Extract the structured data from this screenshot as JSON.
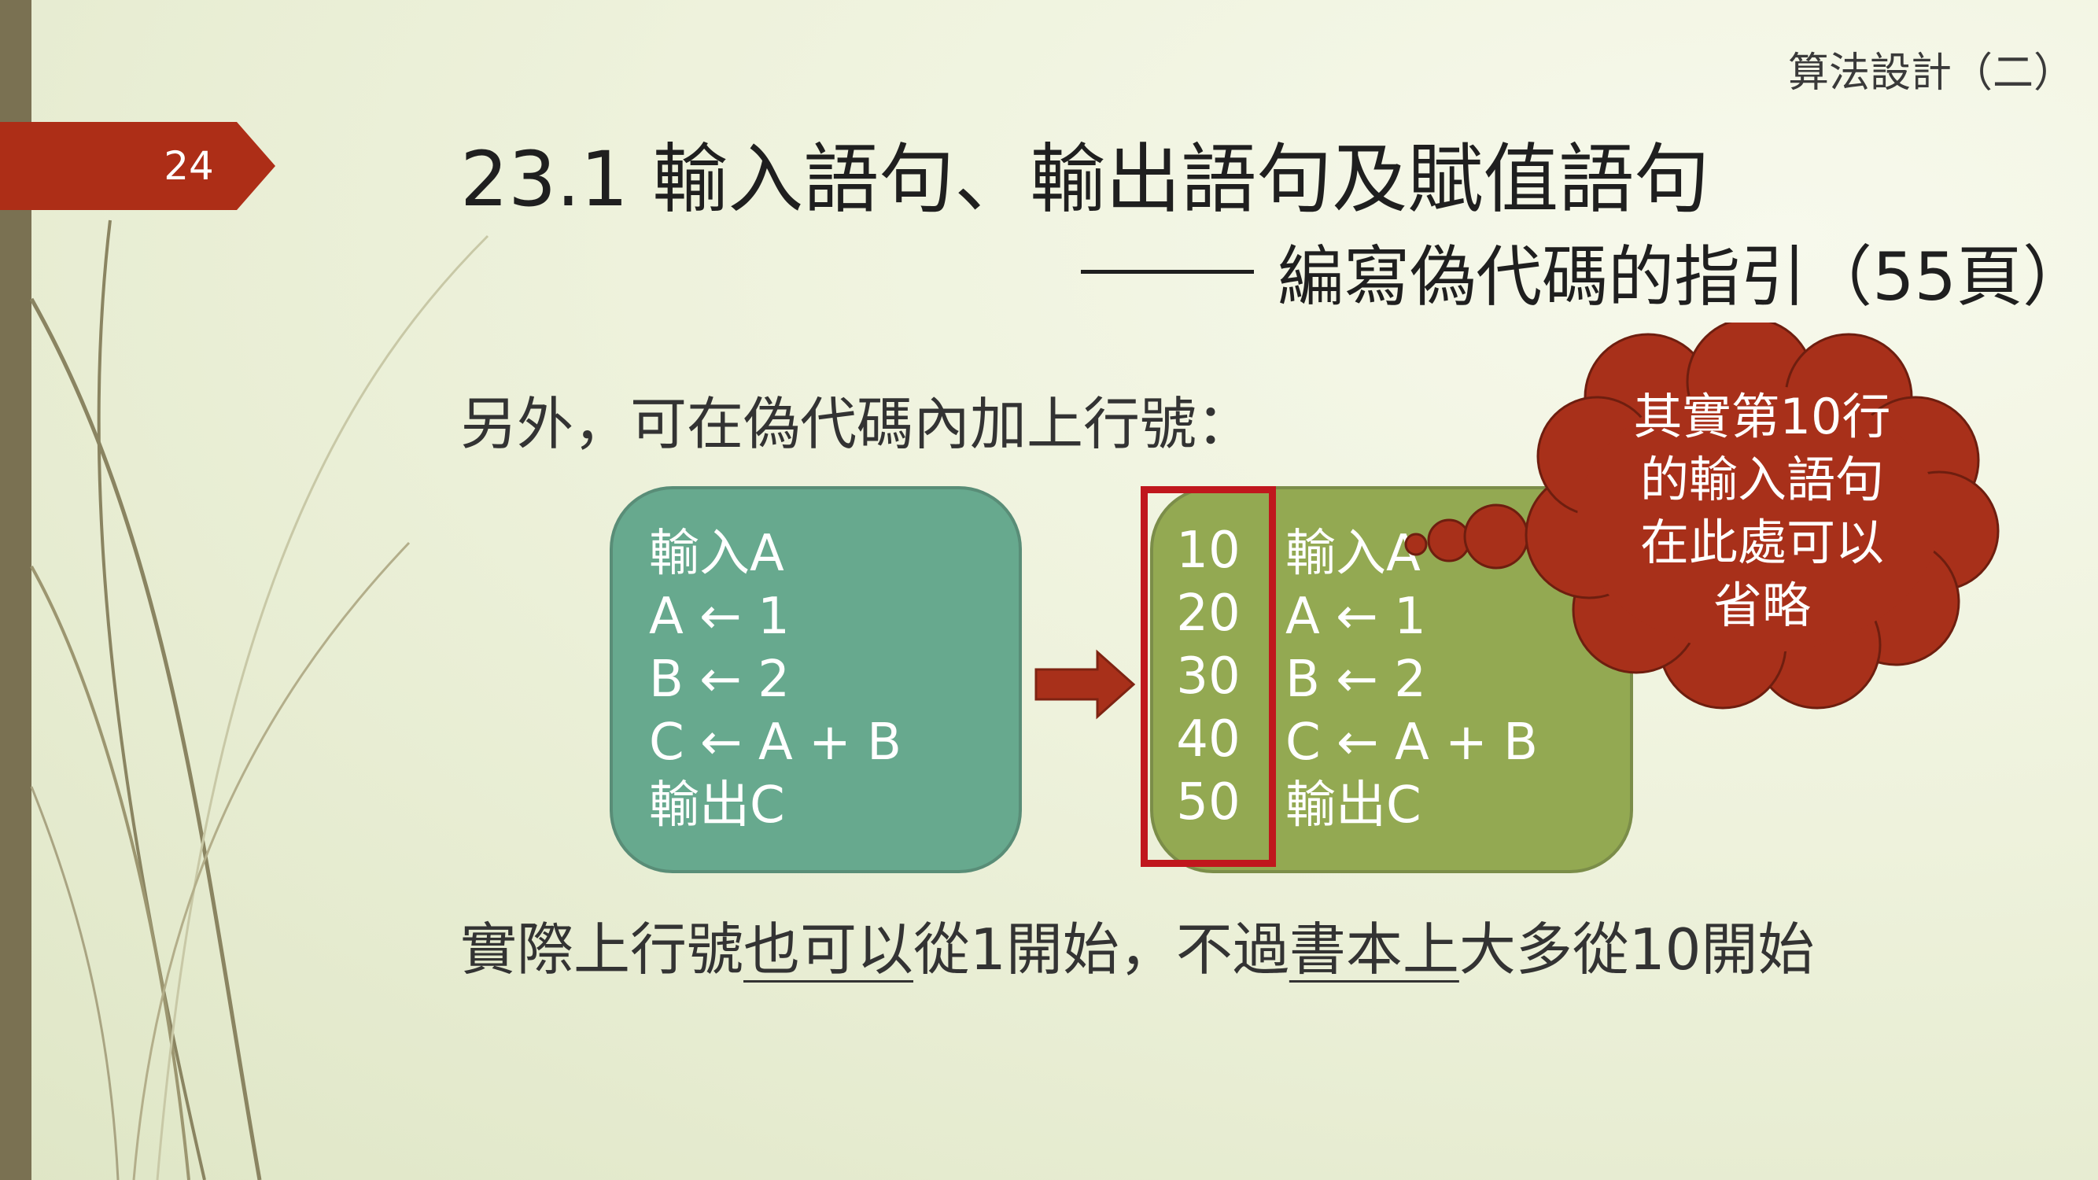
{
  "colors": {
    "accent_tab": "#ad2e17",
    "box_left": "#67a98e",
    "box_right": "#93a952",
    "highlight": "#c0171d",
    "callout": "#a8301a"
  },
  "header": {
    "slide_number": "24",
    "section_label": "算法設計（二）"
  },
  "title": {
    "main": "23.1 輸入語句、輸出語句及賦值語句",
    "subtitle": "編寫偽代碼的指引（55頁）"
  },
  "intro_text": "另外，可在偽代碼內加上行號：",
  "code_box": {
    "lines": [
      "輸入A",
      "A ← 1",
      "B ← 2",
      "C ← A + B",
      "輸出C"
    ]
  },
  "arrow_icon": "right-arrow",
  "numbered_box": {
    "line_numbers": [
      "10",
      "20",
      "30",
      "40",
      "50"
    ],
    "lines": [
      "輸入A",
      "A ← 1",
      "B ← 2",
      "C ← A + B",
      "輸出C"
    ]
  },
  "callout": {
    "lines": [
      "其實第10行",
      "的輸入語句",
      "在此處可以",
      "省略"
    ]
  },
  "footer": {
    "part1": "實際上行號",
    "part2_underlined": "也可以",
    "part3": "從1開始，不過",
    "part4_underlined": "書本上",
    "part5": "大多從10開始"
  }
}
